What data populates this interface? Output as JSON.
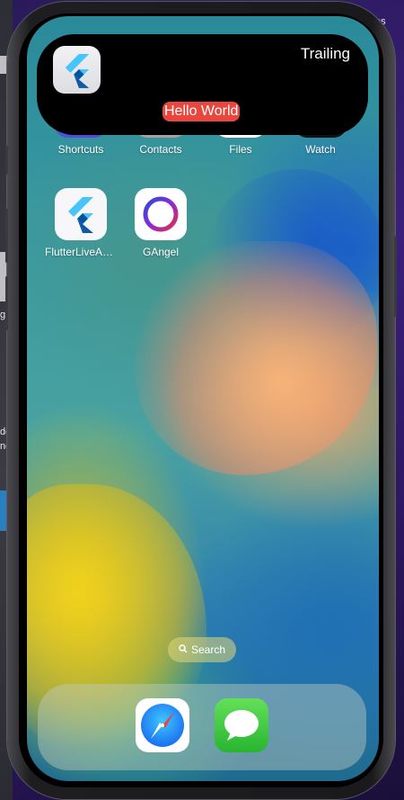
{
  "desktop": {
    "partial_text_top_right": "es",
    "partial_text_left_1": "g",
    "partial_text_left_2": "do",
    "partial_text_left_3": "ng"
  },
  "live_activity": {
    "trailing_label": "Trailing",
    "center_label": "Hello World",
    "app_icon": "flutter-logo-icon",
    "center_label_color": "#e8463f"
  },
  "home_screen": {
    "row1": [
      {
        "label": "Shortcuts",
        "icon": "shortcuts-icon"
      },
      {
        "label": "Contacts",
        "icon": "contacts-icon"
      },
      {
        "label": "Files",
        "icon": "files-icon"
      },
      {
        "label": "Watch",
        "icon": "watch-icon"
      }
    ],
    "row2": [
      {
        "label": "FlutterLiveActi...",
        "icon": "flutter-logo-icon"
      },
      {
        "label": "GAngel",
        "icon": "gangel-ring-icon"
      }
    ]
  },
  "search": {
    "label": "Search",
    "icon": "search-icon"
  },
  "dock": [
    {
      "name": "Safari",
      "icon": "safari-compass-icon"
    },
    {
      "name": "Messages",
      "icon": "messages-bubble-icon"
    }
  ]
}
